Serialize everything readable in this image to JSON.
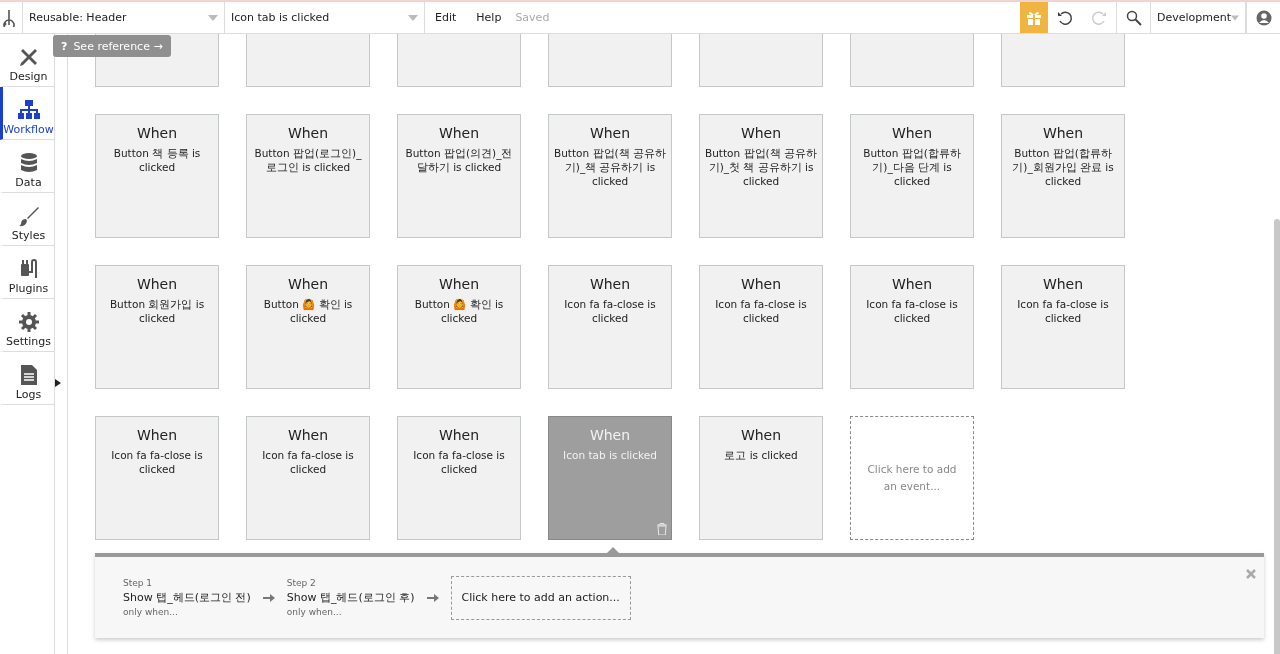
{
  "topbar": {
    "page": "Reusable: Header",
    "event": "Icon tab is clicked",
    "menu": [
      "Edit",
      "Help"
    ],
    "status": "Saved",
    "environment": "Development"
  },
  "sidebar": {
    "items": [
      {
        "label": "Design",
        "kind": "design",
        "selected": false
      },
      {
        "label": "Workflow",
        "kind": "workflow",
        "selected": true
      },
      {
        "label": "Data",
        "kind": "data",
        "selected": false
      },
      {
        "label": "Styles",
        "kind": "styles",
        "selected": false
      },
      {
        "label": "Plugins",
        "kind": "plugins",
        "selected": false
      },
      {
        "label": "Settings",
        "kind": "settings",
        "selected": false
      },
      {
        "label": "Logs",
        "kind": "logs",
        "selected": false
      }
    ]
  },
  "tooltip": {
    "mark": "?",
    "text": "See reference →"
  },
  "rows": [
    {
      "cards": [
        {
          "kind": "blank"
        },
        {
          "kind": "blank"
        },
        {
          "kind": "blank"
        },
        {
          "kind": "blank"
        },
        {
          "kind": "blank"
        },
        {
          "kind": "blank"
        },
        {
          "kind": "blank"
        }
      ]
    },
    {
      "cards": [
        {
          "kind": "event",
          "title": "When",
          "trigger": "Button 책 등록 is clicked",
          "selected": false
        },
        {
          "kind": "event",
          "title": "When",
          "trigger": "Button 팝업(로그인)_로그인 is clicked",
          "selected": false
        },
        {
          "kind": "event",
          "title": "When",
          "trigger": "Button 팝업(의견)_전달하기 is clicked",
          "selected": false
        },
        {
          "kind": "event",
          "title": "When",
          "trigger": "Button 팝업(책 공유하기)_책 공유하기 is clicked",
          "selected": false
        },
        {
          "kind": "event",
          "title": "When",
          "trigger": "Button 팝업(책 공유하기)_첫 책 공유하기 is clicked",
          "selected": false
        },
        {
          "kind": "event",
          "title": "When",
          "trigger": "Button 팝업(합류하기)_다음 단계 is clicked",
          "selected": false
        },
        {
          "kind": "event",
          "title": "When",
          "trigger": "Button 팝업(합류하기)_회원가입 완료 is clicked",
          "selected": false
        }
      ]
    },
    {
      "cards": [
        {
          "kind": "event",
          "title": "When",
          "trigger": "Button 회원가입 is clicked",
          "selected": false
        },
        {
          "kind": "event",
          "title": "When",
          "trigger": "Button 🙆 확인 is clicked",
          "selected": false
        },
        {
          "kind": "event",
          "title": "When",
          "trigger": "Button 🙆 확인 is clicked",
          "selected": false
        },
        {
          "kind": "event",
          "title": "When",
          "trigger": "Icon fa fa-close is clicked",
          "selected": false
        },
        {
          "kind": "event",
          "title": "When",
          "trigger": "Icon fa fa-close is clicked",
          "selected": false
        },
        {
          "kind": "event",
          "title": "When",
          "trigger": "Icon fa fa-close is clicked",
          "selected": false
        },
        {
          "kind": "event",
          "title": "When",
          "trigger": "Icon fa fa-close is clicked",
          "selected": false
        }
      ]
    },
    {
      "cards": [
        {
          "kind": "event",
          "title": "When",
          "trigger": "Icon fa fa-close is clicked",
          "selected": false
        },
        {
          "kind": "event",
          "title": "When",
          "trigger": "Icon fa fa-close is clicked",
          "selected": false
        },
        {
          "kind": "event",
          "title": "When",
          "trigger": "Icon fa fa-close is clicked",
          "selected": false
        },
        {
          "kind": "event",
          "title": "When",
          "trigger": "Icon tab is clicked",
          "selected": true
        },
        {
          "kind": "event",
          "title": "When",
          "trigger": "로고 is clicked",
          "selected": false
        },
        {
          "kind": "add",
          "label": "Click here to add an event..."
        }
      ]
    }
  ],
  "actions": {
    "steps": [
      {
        "step": "Step 1",
        "action": "Show 탭_헤드(로그인 전)",
        "condition": "only when..."
      },
      {
        "step": "Step 2",
        "action": "Show 탭_헤드(로그인 후)",
        "condition": "only when..."
      }
    ],
    "add_label": "Click here to add an action..."
  }
}
